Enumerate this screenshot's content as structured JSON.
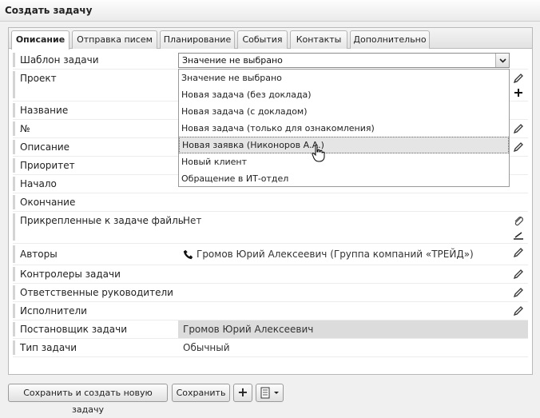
{
  "window": {
    "title": "Создать задачу"
  },
  "tabs": [
    "Описание",
    "Отправка писем",
    "Планирование",
    "События",
    "Контакты",
    "Дополнительно"
  ],
  "template_field": {
    "label": "Шаблон задачи",
    "selected": "Значение не выбрано",
    "options": [
      "Значение не выбрано",
      "Новая задача (без доклада)",
      "Новая задача (с докладом)",
      "Новая задача (только для ознакомления)",
      "Новая заявка (Никоноров А.А.)",
      "Новый клиент",
      "Обращение в ИТ-отдел"
    ],
    "hovered_option": "Новая заявка (Никоноров А.А.)"
  },
  "fields": {
    "project": "Проект",
    "name": "Название",
    "number": "№",
    "description": "Описание",
    "priority": "Приоритет",
    "start": "Начало",
    "end": "Окончание",
    "files": {
      "label": "Прикрепленные к задаче файлы",
      "value": "Нет"
    },
    "authors": {
      "label": "Авторы",
      "value": "Громов Юрий Алексеевич (Группа компаний «ТРЕЙД»)"
    },
    "controllers": "Контролеры задачи",
    "managers": "Ответственные руководители",
    "executors": "Исполнители",
    "setter": {
      "label": "Постановщик задачи",
      "value": "Громов Юрий Алексеевич"
    },
    "type": {
      "label": "Тип задачи",
      "value": "Обычный"
    }
  },
  "buttons": {
    "save_new": "Сохранить и создать новую задачу",
    "save": "Сохранить",
    "add": "+"
  },
  "icons": [
    "pencil-icon",
    "plus-icon",
    "paperclip-icon",
    "scanner-icon",
    "phone-icon",
    "chevron-down-icon",
    "document-icon",
    "hand-cursor-icon"
  ]
}
